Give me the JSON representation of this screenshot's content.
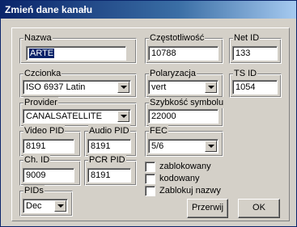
{
  "window": {
    "title": "Zmień dane kanału"
  },
  "fields": {
    "nazwa": {
      "label": "Nazwa",
      "value": "ARTE"
    },
    "czestotliwosc": {
      "label": "Częstotliwość",
      "value": "10788"
    },
    "net_id": {
      "label": "Net ID",
      "value": "133"
    },
    "czcionka": {
      "label": "Czcionka",
      "value": "ISO 6937 Latin"
    },
    "polaryzacja": {
      "label": "Polaryzacja",
      "value": "vert"
    },
    "ts_id": {
      "label": "TS ID",
      "value": "1054"
    },
    "provider": {
      "label": "Provider",
      "value": "CANALSATELLITE"
    },
    "szybkosc_symbolu": {
      "label": "Szybkość symbolu",
      "value": "22000"
    },
    "video_pid": {
      "label": "Video PID",
      "value": "8191"
    },
    "audio_pid": {
      "label": "Audio PID",
      "value": "8191"
    },
    "fec": {
      "label": "FEC",
      "value": "5/6"
    },
    "ch_id": {
      "label": "Ch. ID",
      "value": "9009"
    },
    "pcr_pid": {
      "label": "PCR PID",
      "value": "8191"
    },
    "pids": {
      "label": "PIDs",
      "value": "Dec"
    }
  },
  "checkboxes": {
    "zablokowany": {
      "label": "zablokowany",
      "checked": false
    },
    "kodowany": {
      "label": "kodowany",
      "checked": false
    },
    "zablokuj_nazwy": {
      "label": "Zablokuj nazwy",
      "checked": false
    }
  },
  "buttons": {
    "cancel": "Przerwij",
    "ok": "OK"
  }
}
